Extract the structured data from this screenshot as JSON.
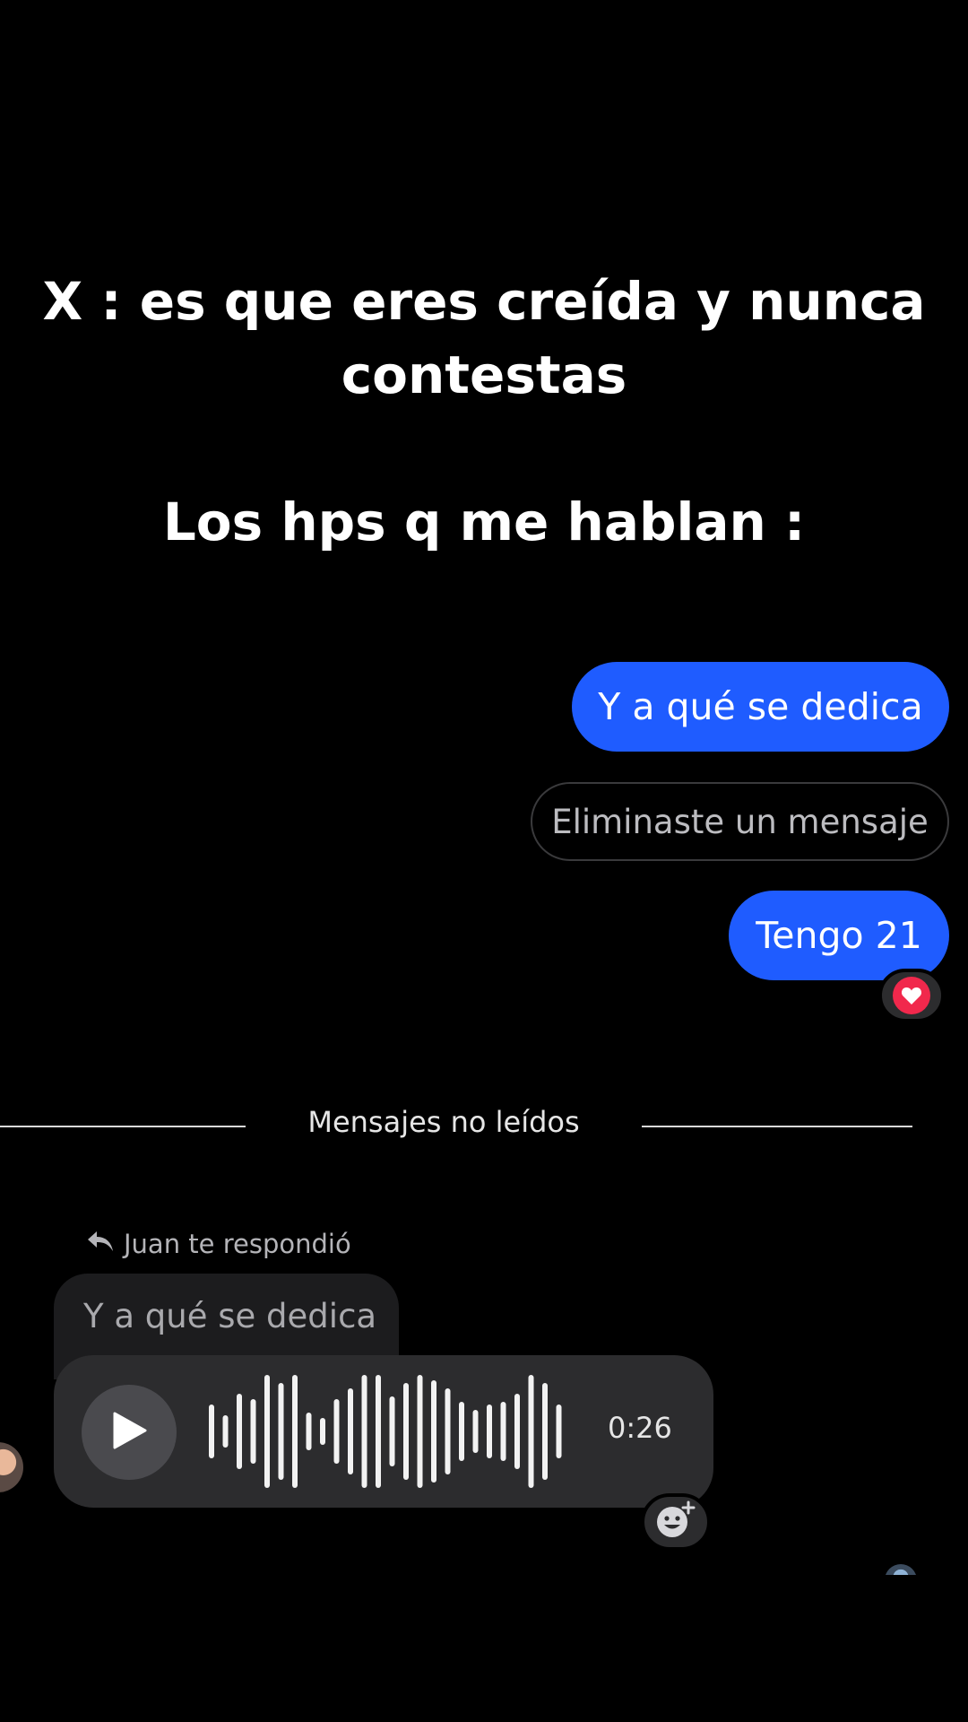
{
  "caption": {
    "line1": "X : es que eres creída y nunca contestas",
    "line2": "Los hps q me hablan :"
  },
  "messages": {
    "outgoing_1": "Y a qué se dedica",
    "deleted_notice": "Eliminaste un mensaje",
    "outgoing_2": "Tengo 21",
    "outgoing_2_reaction": "heart-icon"
  },
  "separator": {
    "label": "Mensajes no leídos"
  },
  "incoming": {
    "reply_hint": "Juan te respondió",
    "quoted_text": "Y a qué se dedica",
    "voice_duration": "0:26"
  },
  "colors": {
    "background": "#000000",
    "outgoing_bubble": "#1f5cff",
    "incoming_bubble": "#2c2c2e",
    "heart": "#f1284c"
  }
}
